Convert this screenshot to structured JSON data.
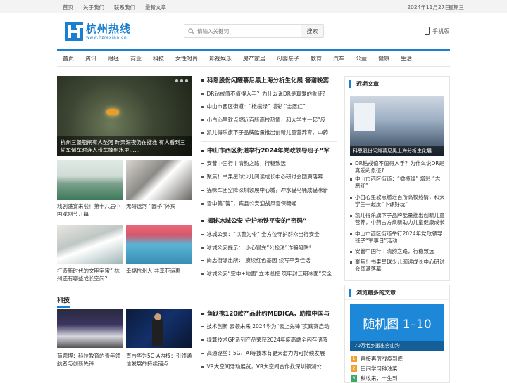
{
  "topbar": {
    "links": [
      "首页",
      "关于我们",
      "联系我们",
      "最新文章"
    ],
    "date": "2024年11月27日",
    "weekday": "星期三"
  },
  "header": {
    "logo_name": "杭州热线",
    "logo_url": "www.hzrexian.cn",
    "search_placeholder": "请输入关键词",
    "search_button": "搜索",
    "mobile": "手机版"
  },
  "nav": [
    "首页",
    "资讯",
    "财经",
    "商业",
    "科技",
    "女性时尚",
    "影视娱乐",
    "房产家居",
    "母婴亲子",
    "教育",
    "汽车",
    "公益",
    "健康",
    "生活"
  ],
  "slider": {
    "caption": "杭州三堡船闸有人坠河 昨天深夜仍在搜救 有人看到三轮车倒车时连人带车掉到水里……"
  },
  "thumbs1": [
    {
      "caption": "戏剧盛宴来啦！第十八届中国戏剧节开幕"
    },
    {
      "caption": "无碍运河 “圆桥”外宾"
    },
    {
      "caption": "打造新时代的文明宇宙” 杭州还有哪些成长空间?"
    },
    {
      "caption": "幸福杭州人 共享亚运惠"
    }
  ],
  "news_groups": [
    {
      "headline": "科恩股份闪耀慕尼黑上海分析生化展 答谢晚宴",
      "items": [
        "DR钻戒值不值得入手？为什么说DR是真爱的象征?",
        "中山市西区街道：“橄榄绿” 增彩 “志愿红”",
        "小白心里软点燃近百所高校热情，和大学生一起“皮",
        "凯儿得乐旗下子品牌酷量推出创新儿童营养育，中药"
      ]
    },
    {
      "headline": "中山市西区街道举行2024年党政领导班子“军",
      "items": [
        "安普中国行丨清韵之路，行稳致远",
        "聚焦！书果星球少儿阅读成长中心研讨会圆满落幕",
        "猫咪军团空降深圳领展中心城，冲水猫马桶成猫咪新",
        "雪中美“警”，宾县公安迎战风雪保畅通"
      ]
    },
    {
      "headline": "揭秘冰城公安 守护地铁平安的“密码”",
      "items": [
        "冰城公安：“以警为令” 全方位守护群众出行安全",
        "冰城公安提示： 小心冒充“公检法”诈骗陷阱!",
        "尚志街派出所： 赓续红色基因 续写平安佳话",
        "冰城公安“空中+地面”立体巡控 筑牢封江期冰面“安全"
      ]
    }
  ],
  "tech": {
    "title": "科技",
    "thumbs": [
      {
        "caption": "荀题博：科技教育的青年领航者与创新先锋"
      },
      {
        "caption": "直击华为5G-A内核：引领通信发展的持续锚点"
      }
    ],
    "headline": "鱼跃携120款产品赴约MEDICA，助推中国与",
    "items": [
      "技术创新 云领未来 2024华为“云上先锋”实践赛启动",
      "绿算技术GP系列产品荣获2024年度高端全闪存储阵",
      "高通铿堃：5G、AI等技术有更大潜力为可持续发展",
      "VR大空间活动展览，VR大空间合作找深圳领湖公"
    ]
  },
  "sidebar": {
    "latest_title": "近期文章",
    "latest_img_caption": "科恩股份闪耀慕尼黑上海分析生化展",
    "latest_items": [
      "DR钻戒值不值得入手？为什么说DR是真爱的象征?",
      "中山市西区街道：“橄榄绿” 增彩 “志愿红”",
      "小白心里软点燃近百所高校热情，和大学生一起度“下课好玩”",
      "凯儿得乐旗下子品牌酷量推出创新儿童营养，中药古方焕新助力儿童健康成长",
      "中山市西区街道举行2024年党政领导班子“军事日”活动",
      "安普中国行丨清韵之路，行稳致远",
      "聚焦！书果星球少儿阅读成长中心研讨会圆满落幕"
    ],
    "popular_title": "浏览最多的文章",
    "banner_text": "随机图 1–10",
    "banner_caption": "70万老乡搬出穷山沟",
    "ranks": [
      {
        "num": "1",
        "text": "再接再厉战疫到底"
      },
      {
        "num": "2",
        "text": "田间学习种油菜"
      },
      {
        "num": "3",
        "text": "秋收来，丰生到"
      }
    ],
    "rank_colors": [
      "#f0a030",
      "#f0a030",
      "#3aa86b"
    ]
  }
}
